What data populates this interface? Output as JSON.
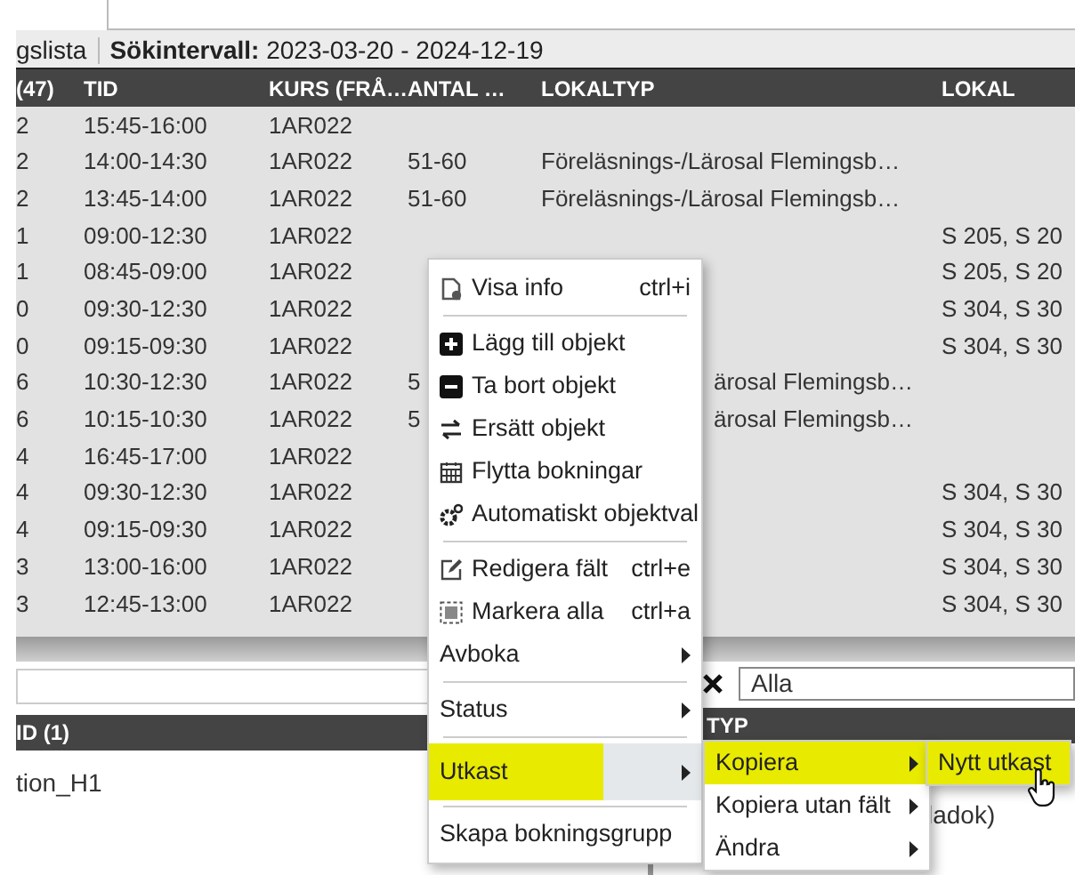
{
  "toolbar": {
    "title": "gslista",
    "interval_label": "Sökintervall:",
    "interval_value": "2023-03-20 - 2024-12-19"
  },
  "table": {
    "columns": [
      "(47)",
      "TID",
      "KURS (FRÅ…",
      "ANTAL …",
      "LOKALTYP",
      "LOKAL"
    ],
    "rows": [
      {
        "column_1": "2",
        "tid": "15:45-16:00",
        "kurs": "1AR022"
      },
      {
        "column_1": "2",
        "tid": "14:00-14:30",
        "kurs": "1AR022",
        "antal": "51-60",
        "lokaltyp": "Föreläsnings-/Lärosal Flemingsb…"
      },
      {
        "column_1": "2",
        "tid": "13:45-14:00",
        "kurs": "1AR022",
        "antal": "51-60",
        "lokaltyp": "Föreläsnings-/Lärosal Flemingsb…"
      },
      {
        "column_1": "1",
        "tid": "09:00-12:30",
        "kurs": "1AR022",
        "lokal": "S 205, S 20"
      },
      {
        "column_1": "1",
        "tid": "08:45-09:00",
        "kurs": "1AR022",
        "lokal": "S 205, S 20"
      },
      {
        "column_1": "0",
        "tid": "09:30-12:30",
        "kurs": "1AR022",
        "lokal": "S 304, S 30"
      },
      {
        "column_1": "0",
        "tid": "09:15-09:30",
        "kurs": "1AR022",
        "lokal": "S 304, S 30"
      },
      {
        "column_1": "6",
        "tid": "10:30-12:30",
        "kurs": "1AR022",
        "antal": "5",
        "lokaltyp_tail": "ärosal Flemingsb…"
      },
      {
        "column_1": "6",
        "tid": "10:15-10:30",
        "kurs": "1AR022",
        "antal": "5",
        "lokaltyp_tail": "ärosal Flemingsb…"
      },
      {
        "column_1": "4",
        "tid": "16:45-17:00",
        "kurs": "1AR022"
      },
      {
        "column_1": "4",
        "tid": "09:30-12:30",
        "kurs": "1AR022",
        "lokal": "S 304, S 30"
      },
      {
        "column_1": "4",
        "tid": "09:15-09:30",
        "kurs": "1AR022",
        "lokal": "S 304, S 30"
      },
      {
        "column_1": "3",
        "tid": "13:00-16:00",
        "kurs": "1AR022",
        "lokal": "S 304, S 30"
      },
      {
        "column_1": "3",
        "tid": "12:45-13:00",
        "kurs": "1AR022",
        "lokal": "S 304, S 30"
      }
    ]
  },
  "left_pane": {
    "columns": [
      "ID (1)"
    ],
    "rows": [
      "tion_H1"
    ]
  },
  "right_pane": {
    "filter_value": "Alla",
    "columns": [
      "TYP"
    ],
    "rows": [
      "ladok)"
    ]
  },
  "context_menu": [
    {
      "kind": "item",
      "label": "Visa info",
      "shortcut": "ctrl+i",
      "selected": false
    },
    {
      "kind": "separator"
    },
    {
      "kind": "item",
      "label": "Lägg till objekt",
      "selected": false
    },
    {
      "kind": "item",
      "label": "Ta bort objekt",
      "selected": false
    },
    {
      "kind": "item",
      "label": "Ersätt objekt",
      "selected": false
    },
    {
      "kind": "item",
      "label": "Flytta bokningar",
      "selected": false
    },
    {
      "kind": "item",
      "label": "Automatiskt objektval",
      "selected": false
    },
    {
      "kind": "separator"
    },
    {
      "kind": "item",
      "label": "Redigera fält",
      "shortcut": "ctrl+e",
      "selected": false
    },
    {
      "kind": "item",
      "label": "Markera alla",
      "shortcut": "ctrl+a",
      "selected": false
    },
    {
      "kind": "submenu",
      "label": "Avboka",
      "selected": false
    },
    {
      "kind": "separator"
    },
    {
      "kind": "submenu",
      "label": "Status",
      "selected": false
    },
    {
      "kind": "separator"
    },
    {
      "kind": "submenu",
      "label": "Utkast",
      "selected": true
    },
    {
      "kind": "separator"
    },
    {
      "kind": "item",
      "label": "Skapa bokningsgrupp",
      "selected": false
    }
  ],
  "submenu": [
    {
      "kind": "submenu",
      "label": "Kopiera",
      "selected": true
    },
    {
      "kind": "submenu",
      "label": "Kopiera utan fält",
      "selected": false
    },
    {
      "kind": "submenu",
      "label": "Ändra",
      "selected": false
    }
  ],
  "submenu_2": [
    {
      "kind": "item",
      "label": "Nytt utkast",
      "selected": true
    }
  ]
}
